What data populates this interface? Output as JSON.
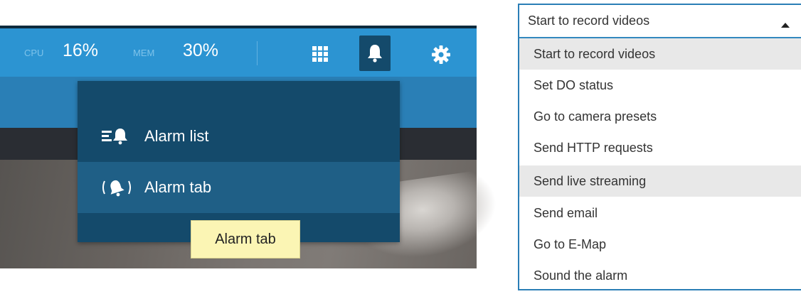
{
  "topbar": {
    "cpu_label": "CPU",
    "cpu_value": "16%",
    "mem_label": "MEM",
    "mem_value": "30%",
    "icons": [
      "apps-grid-icon",
      "bell-icon",
      "gear-icon"
    ]
  },
  "alarm_menu": {
    "items": [
      {
        "label": "Alarm list",
        "icon": "alarm-list-icon"
      },
      {
        "label": "Alarm tab",
        "icon": "alarm-tab-icon",
        "hovered": true
      }
    ],
    "tooltip": "Alarm tab"
  },
  "action_select": {
    "selected": "Start to record videos",
    "options": [
      "Start to record videos",
      "Set DO status",
      "Go to camera presets",
      "Send HTTP requests",
      "Send live streaming",
      "Send email",
      "Go to E-Map",
      "Sound the alarm"
    ],
    "highlighted": [
      "Start to record videos",
      "Send live streaming"
    ]
  },
  "colors": {
    "topbar_blue": "#2c94d2",
    "menu_navy": "#144a6b",
    "menu_hover": "#1f5f86",
    "tooltip_yellow": "#fbf5b4",
    "select_border": "#2a7eb6"
  }
}
